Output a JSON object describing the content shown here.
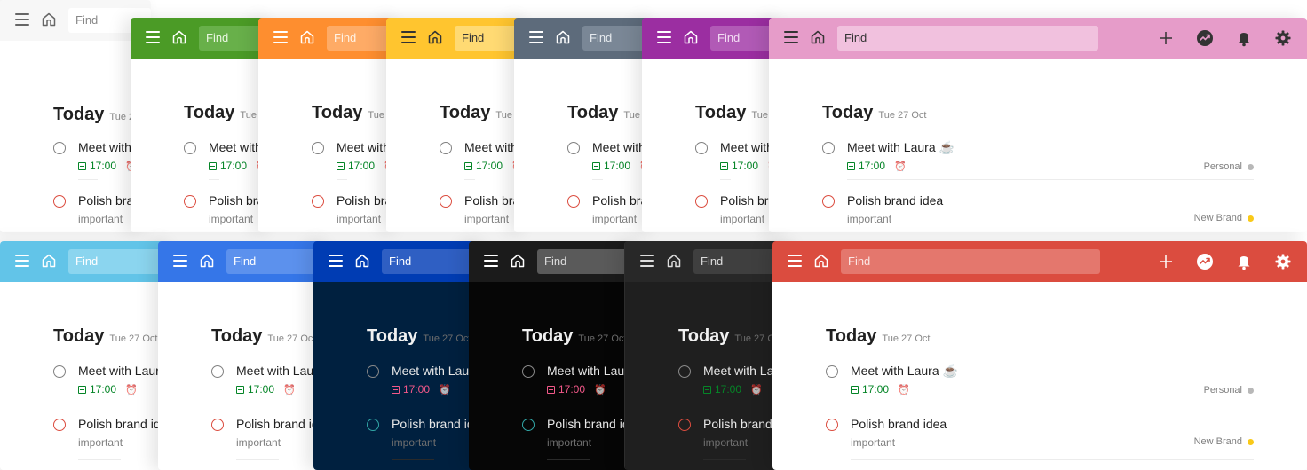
{
  "header": {
    "search_placeholder": "Find"
  },
  "today": {
    "title": "Today",
    "date": "Tue 27 Oct"
  },
  "tasks": [
    {
      "name": "Meet with Laura",
      "emoji": "☕",
      "time": "17:00",
      "project": "Personal",
      "project_color": "#b8b8b8"
    },
    {
      "name": "Polish brand idea",
      "label": "important",
      "project": "New Brand",
      "project_color": "#f9c918"
    }
  ],
  "icons": [
    "menu-icon",
    "home-icon",
    "add-icon",
    "productivity-icon",
    "bell-icon",
    "gear-icon",
    "alarm-icon",
    "calendar-icon"
  ],
  "themes": {
    "top": [
      "#f6f6f6",
      "#4a9b25",
      "#fd8d2e",
      "#ffc52e",
      "#5c6b7a",
      "#9b2ea0",
      "#e59bc8"
    ],
    "bottom": [
      "#61c4e8",
      "#3576e8",
      "#003bb3",
      "#1a1a1a",
      "#282828",
      "#db4c3f"
    ]
  }
}
